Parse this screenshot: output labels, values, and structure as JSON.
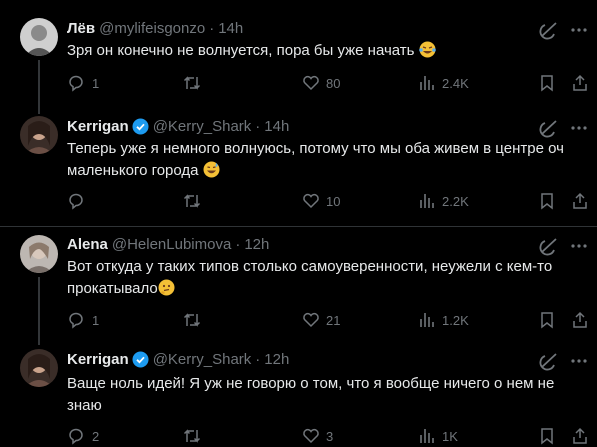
{
  "tweets": [
    {
      "name": "Лёв",
      "handle": "@mylifeisgonzo",
      "time": "14h",
      "text": "Зря он конечно не волнуется, пора бы уже начать",
      "text_emoji": "crying-laughing-emoji",
      "replies": "1",
      "retweets": "",
      "likes": "80",
      "views": "2.4K",
      "verified": false
    },
    {
      "name": "Kerrigan",
      "handle": "@Kerry_Shark",
      "time": "14h",
      "text": "Теперь уже я немного волнуюсь, потому что мы оба живем в центре оч маленького города",
      "text_emoji": "sweat-smile-emoji",
      "replies": "",
      "retweets": "",
      "likes": "10",
      "views": "2.2K",
      "verified": true
    },
    {
      "name": "Alena",
      "handle": "@HelenLubimova",
      "time": "12h",
      "text": "Вот откуда у таких типов столько самоуверенности, неужели с кем-то прокатывало",
      "text_emoji": "thinking-emoji",
      "replies": "1",
      "retweets": "",
      "likes": "21",
      "views": "1.2K",
      "verified": false
    },
    {
      "name": "Kerrigan",
      "handle": "@Kerry_Shark",
      "time": "12h",
      "text": "Ваще ноль идей! Я уж не говорю о том, что я вообще ничего о нем не знаю",
      "text_emoji": "",
      "replies": "2",
      "retweets": "",
      "likes": "3",
      "views": "1K",
      "verified": true
    }
  ],
  "colors": {
    "background": "#000000",
    "text": "#e7e9ea",
    "muted": "#71767b",
    "verified": "#1d9bf0",
    "divider": "#2f3336"
  }
}
